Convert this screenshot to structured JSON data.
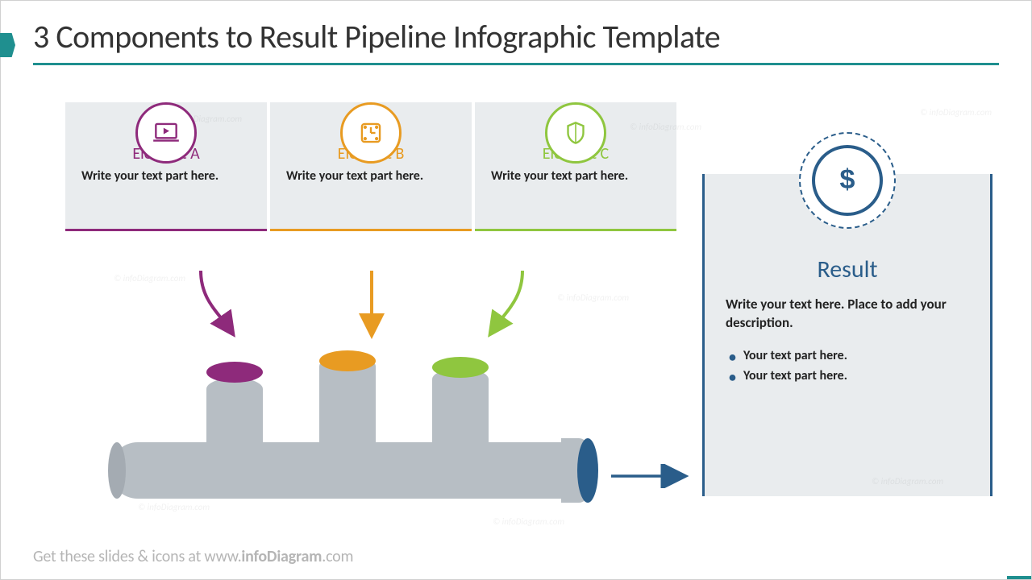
{
  "title": "3 Components to Result Pipeline Infographic Template",
  "components": [
    {
      "label": "Element A",
      "desc": "Write your text part here.",
      "color": "#8e2a7b",
      "icon": "laptop-play-icon"
    },
    {
      "label": "Element B",
      "desc": "Write your text part here.",
      "color": "#e89b22",
      "icon": "clock-square-icon"
    },
    {
      "label": "Element C",
      "desc": "Write your text part here.",
      "color": "#8fc63f",
      "icon": "shield-icon"
    }
  ],
  "result": {
    "title": "Result",
    "desc": "Write your text here. Place to add your description.",
    "bullets": [
      "Your text part here.",
      "Your text part here."
    ],
    "color": "#2a5d8a",
    "icon": "dollar-icon"
  },
  "footer": {
    "prefix": "Get these slides & icons at www.",
    "brand": "infoDiagram",
    "suffix": ".com"
  },
  "watermark": "© infoDiagram.com"
}
